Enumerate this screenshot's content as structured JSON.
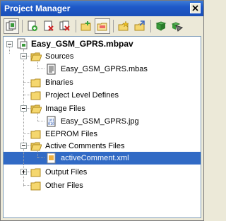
{
  "window": {
    "title": "Project Manager"
  },
  "toolbar": {
    "buttons": [
      {
        "icon": "project-icon"
      },
      {
        "icon": "add-file-icon"
      },
      {
        "icon": "remove-file-icon"
      },
      {
        "icon": "remove-all-icon"
      },
      {
        "icon": "new-folder-icon"
      },
      {
        "icon": "delete-folder-icon"
      },
      {
        "icon": "new-project-icon"
      },
      {
        "icon": "open-project-icon"
      },
      {
        "icon": "build-icon"
      },
      {
        "icon": "build-all-icon"
      }
    ]
  },
  "tree": {
    "root": "Easy_GSM_GPRS.mbpav",
    "items": [
      {
        "label": "Sources"
      },
      {
        "label": "Easy_GSM_GPRS.mbas"
      },
      {
        "label": "Binaries"
      },
      {
        "label": "Project Level Defines"
      },
      {
        "label": "Image Files"
      },
      {
        "label": "Easy_GSM_GPRS.jpg"
      },
      {
        "label": "EEPROM Files"
      },
      {
        "label": "Active Comments Files"
      },
      {
        "label": "activeComment.xml"
      },
      {
        "label": "Output Files"
      },
      {
        "label": "Other Files"
      }
    ]
  },
  "colors": {
    "selection": "#316ac5",
    "titlebar": "#1e59c8",
    "folder": "#f5d76e"
  }
}
